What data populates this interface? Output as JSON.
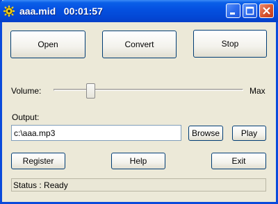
{
  "titlebar": {
    "title": "aaa.mid   00:01:57",
    "icon": "gear-icon"
  },
  "buttons": {
    "open": "Open",
    "convert": "Convert",
    "stop": "Stop",
    "browse": "Browse",
    "play": "Play",
    "register": "Register",
    "help": "Help",
    "exit": "Exit"
  },
  "volume": {
    "label": "Volume:",
    "max_label": "Max",
    "level": 0.18
  },
  "output": {
    "label": "Output:",
    "value": "c:\\aaa.mp3"
  },
  "status": {
    "text": "Status : Ready"
  },
  "colors": {
    "titlebar": "#0551E1",
    "window_bg": "#ECE9D8",
    "close_button": "#D6532E"
  }
}
